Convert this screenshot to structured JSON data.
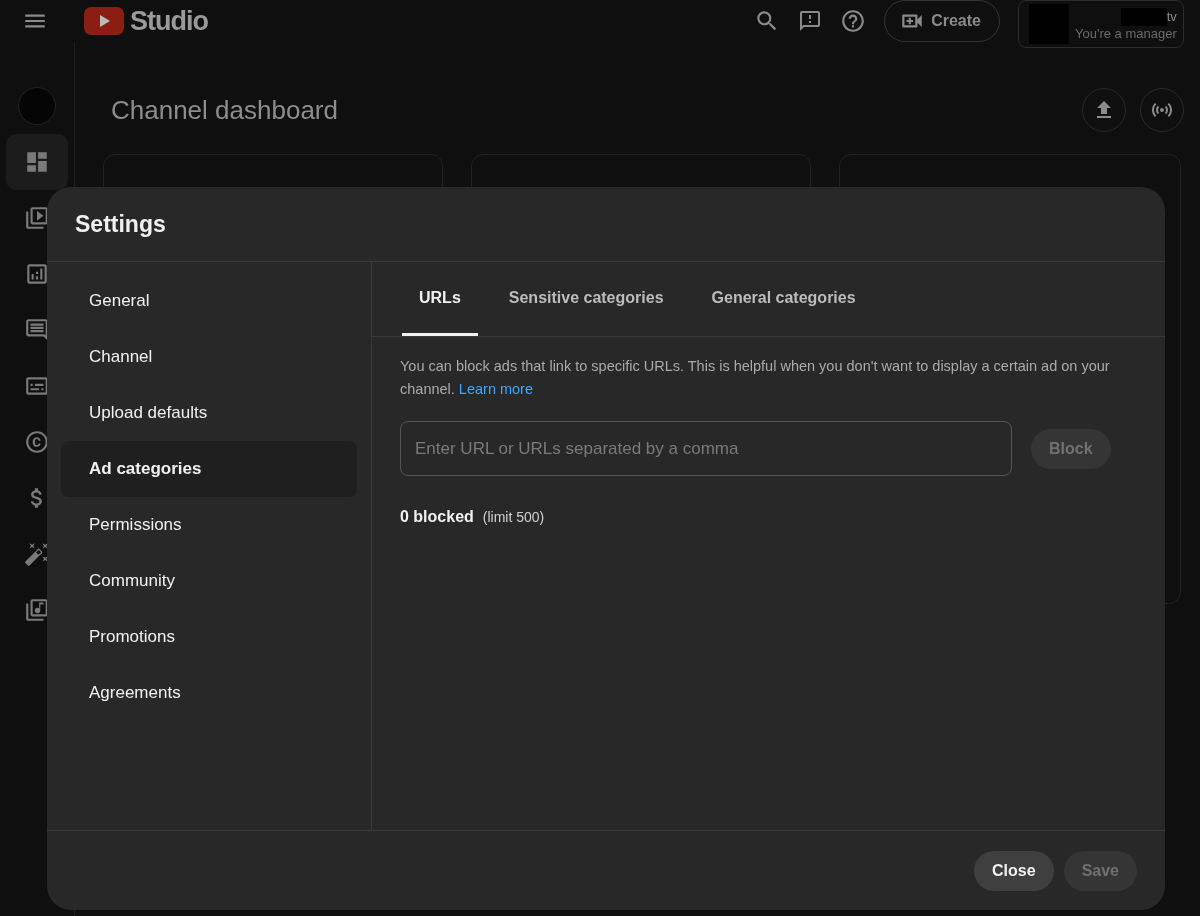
{
  "topbar": {
    "logo_text": "Studio",
    "create_label": "Create",
    "account": {
      "name": "tv",
      "role": "You're a manager"
    }
  },
  "rail": {
    "items": [
      {
        "kind": "avatar",
        "selected": false
      },
      {
        "kind": "dashboard",
        "selected": true
      },
      {
        "kind": "content",
        "selected": false
      },
      {
        "kind": "analytics",
        "selected": false
      },
      {
        "kind": "comments",
        "selected": false
      },
      {
        "kind": "subtitles",
        "selected": false
      },
      {
        "kind": "copyright",
        "selected": false
      },
      {
        "kind": "earn",
        "selected": false
      },
      {
        "kind": "customization",
        "selected": false
      },
      {
        "kind": "audio",
        "selected": false
      }
    ]
  },
  "page": {
    "title": "Channel dashboard"
  },
  "settings": {
    "title": "Settings",
    "nav": [
      {
        "label": "General",
        "selected": false
      },
      {
        "label": "Channel",
        "selected": false
      },
      {
        "label": "Upload defaults",
        "selected": false
      },
      {
        "label": "Ad categories",
        "selected": true
      },
      {
        "label": "Permissions",
        "selected": false
      },
      {
        "label": "Community",
        "selected": false
      },
      {
        "label": "Promotions",
        "selected": false
      },
      {
        "label": "Agreements",
        "selected": false
      }
    ],
    "tabs": [
      {
        "label": "URLs",
        "selected": true
      },
      {
        "label": "Sensitive categories",
        "selected": false
      },
      {
        "label": "General categories",
        "selected": false
      }
    ],
    "description": "You can block ads that link to specific URLs. This is helpful when you don't want to display a certain ad on your channel.",
    "learn_more": "Learn more",
    "url_field": {
      "placeholder": "Enter URL or URLs separated by a comma"
    },
    "block_button": {
      "label": "Block",
      "disabled": true
    },
    "blocked_count": "0 blocked",
    "limit": "(limit 500)",
    "buttons": [
      {
        "label": "Close",
        "disabled": false
      },
      {
        "label": "Save",
        "disabled": true
      }
    ]
  }
}
